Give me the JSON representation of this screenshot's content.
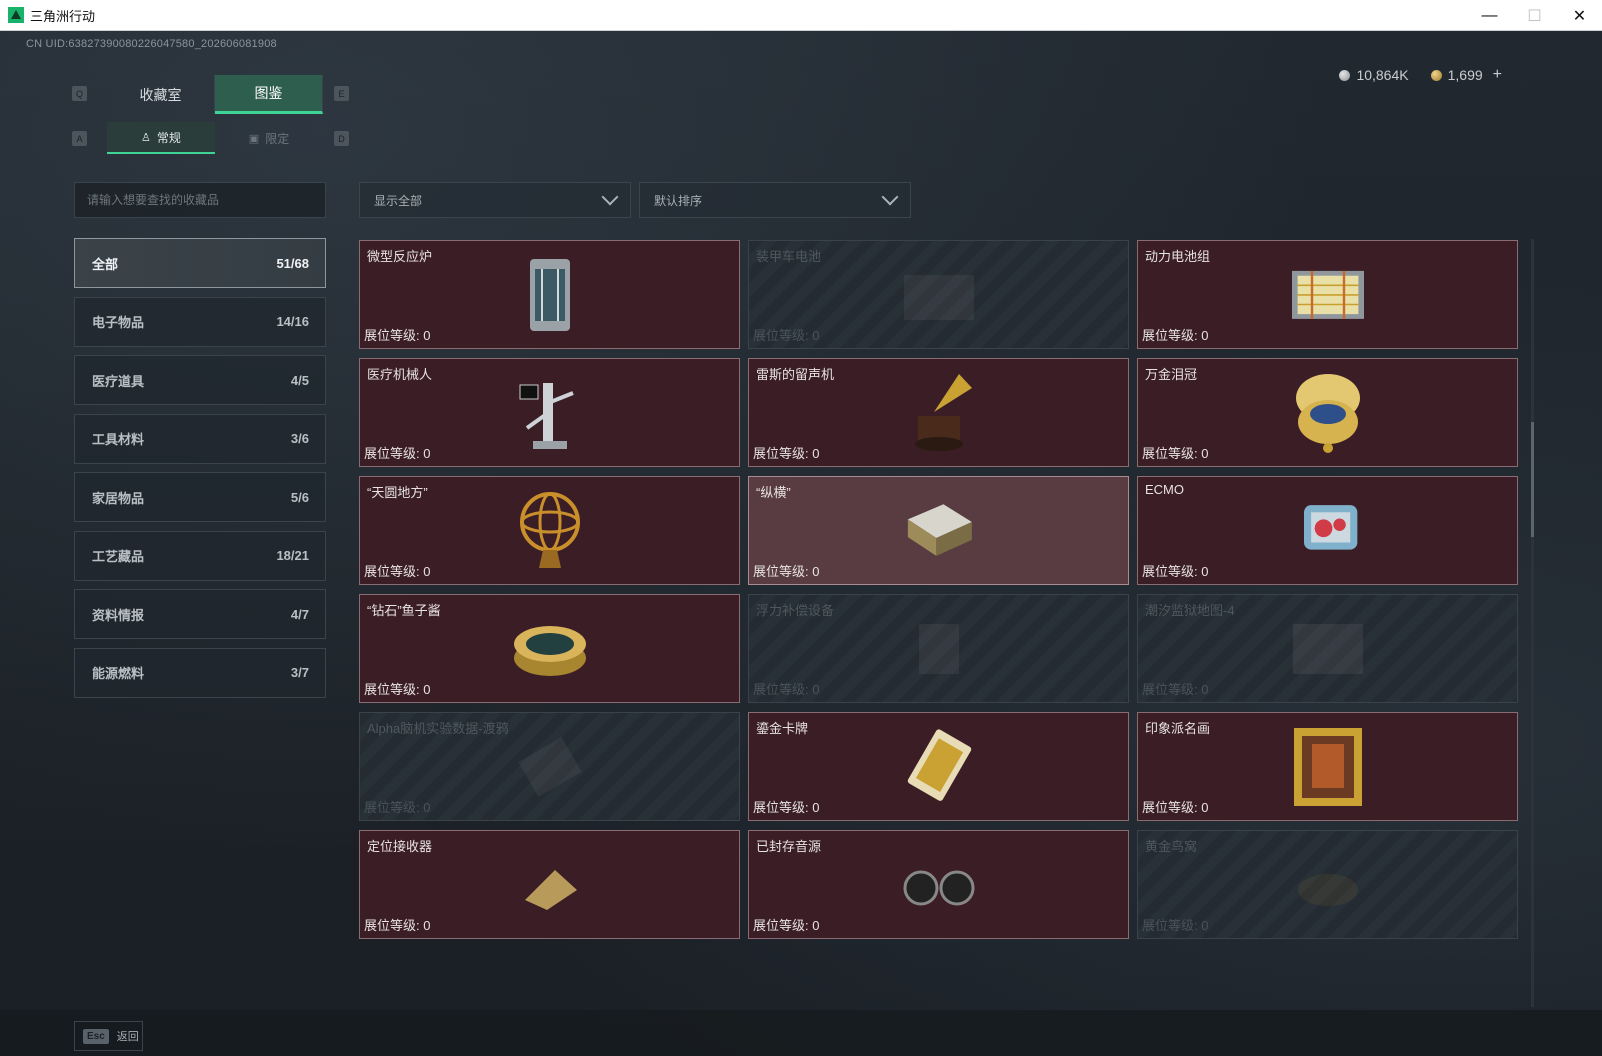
{
  "window": {
    "title": "三角洲行动",
    "minimize": "—",
    "maximize": "☐",
    "close": "✕"
  },
  "uid": "CN UID:63827390080226047580_202606081908",
  "currency": {
    "silver": "10,864K",
    "gold": "1,699",
    "plus": "+"
  },
  "keyhints": {
    "q": "Q",
    "e": "E",
    "a": "A",
    "d": "D"
  },
  "tabs": {
    "top": [
      {
        "label": "收藏室"
      },
      {
        "label": "图鉴"
      }
    ],
    "sub": [
      {
        "label": "常规",
        "icon": "figure-icon"
      },
      {
        "label": "限定",
        "icon": "image-icon"
      }
    ]
  },
  "search": {
    "placeholder": "请输入想要查找的收藏品"
  },
  "filters": {
    "show": "显示全部",
    "sort": "默认排序"
  },
  "categories": [
    {
      "label": "全部",
      "count": "51/68"
    },
    {
      "label": "电子物品",
      "count": "14/16"
    },
    {
      "label": "医疗道具",
      "count": "4/5"
    },
    {
      "label": "工具材料",
      "count": "3/6"
    },
    {
      "label": "家居物品",
      "count": "5/6"
    },
    {
      "label": "工艺藏品",
      "count": "18/21"
    },
    {
      "label": "资料情报",
      "count": "4/7"
    },
    {
      "label": "能源燃料",
      "count": "3/7"
    }
  ],
  "items": [
    {
      "name": "",
      "level": "展位等级: 0",
      "icon": "bag-icon",
      "locked": true
    },
    {
      "name": "",
      "level": "展位等级: 0",
      "icon": "robot-vacuum-icon",
      "locked": false
    },
    {
      "name": "",
      "level": "展位等级: 0",
      "icon": "coffee-bag-icon",
      "locked": false
    },
    {
      "name": "微型反应炉",
      "level": "展位等级: 0",
      "icon": "reactor-icon",
      "locked": false
    },
    {
      "name": "装甲车电池",
      "level": "展位等级: 0",
      "icon": "battery-icon",
      "locked": true
    },
    {
      "name": "动力电池组",
      "level": "展位等级: 0",
      "icon": "battery-pack-icon",
      "locked": false
    },
    {
      "name": "医疗机械人",
      "level": "展位等级: 0",
      "icon": "medical-robot-icon",
      "locked": false
    },
    {
      "name": "雷斯的留声机",
      "level": "展位等级: 0",
      "icon": "gramophone-icon",
      "locked": false
    },
    {
      "name": "万金泪冠",
      "level": "展位等级: 0",
      "icon": "jeweled-egg-icon",
      "locked": false
    },
    {
      "name": "“天圆地方”",
      "level": "展位等级: 0",
      "icon": "armillary-sphere-icon",
      "locked": false
    },
    {
      "name": "“纵横”",
      "level": "展位等级: 0",
      "icon": "chess-box-icon",
      "locked": false,
      "selected": true
    },
    {
      "name": "ECMO",
      "level": "展位等级: 0",
      "icon": "ecmo-icon",
      "locked": false
    },
    {
      "name": "“钻石”鱼子酱",
      "level": "展位等级: 0",
      "icon": "caviar-tin-icon",
      "locked": false
    },
    {
      "name": "浮力补偿设备",
      "level": "展位等级: 0",
      "icon": "buoyancy-device-icon",
      "locked": true
    },
    {
      "name": "潮汐监狱地图-4",
      "level": "展位等级: 0",
      "icon": "map-icon",
      "locked": true
    },
    {
      "name": "Alpha脑机实验数据-渡鸦",
      "level": "展位等级: 0",
      "icon": "data-drive-icon",
      "locked": true
    },
    {
      "name": "鎏金卡牌",
      "level": "展位等级: 0",
      "icon": "golden-card-icon",
      "locked": false
    },
    {
      "name": "印象派名画",
      "level": "展位等级: 0",
      "icon": "painting-icon",
      "locked": false
    },
    {
      "name": "定位接收器",
      "level": "展位等级: 0",
      "icon": "receiver-icon",
      "locked": false
    },
    {
      "name": "已封存音源",
      "level": "展位等级: 0",
      "icon": "reel-tape-icon",
      "locked": false
    },
    {
      "name": "黄金鸟窝",
      "level": "展位等级: 0",
      "icon": "golden-nest-icon",
      "locked": true
    }
  ],
  "footer": {
    "esc_key": "Esc",
    "back_label": "返回"
  },
  "colors": {
    "accent": "#3fd495",
    "card_owned": "#3b1e25",
    "card_selected": "#583c41"
  }
}
